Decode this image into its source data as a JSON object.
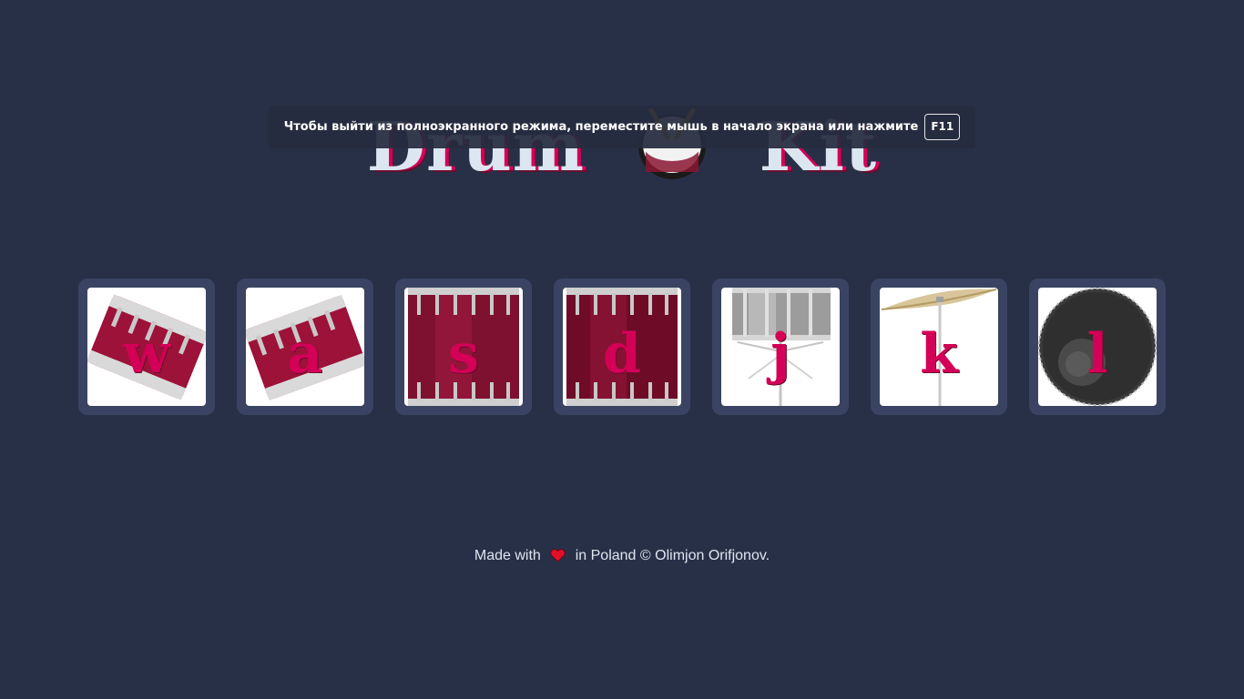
{
  "header": {
    "title_left": "Drum",
    "title_right": "Kit"
  },
  "fullscreen_notice": {
    "message": "Чтобы выйти из полноэкранного режима, переместите мышь в начало экрана или нажмите",
    "key": "F11"
  },
  "drums": [
    {
      "key": "w",
      "icon": "tom-drum-icon"
    },
    {
      "key": "a",
      "icon": "tom-drum-icon"
    },
    {
      "key": "s",
      "icon": "floor-tom-icon"
    },
    {
      "key": "d",
      "icon": "floor-tom-icon"
    },
    {
      "key": "j",
      "icon": "snare-drum-icon"
    },
    {
      "key": "k",
      "icon": "cymbal-icon"
    },
    {
      "key": "l",
      "icon": "bass-drum-icon"
    }
  ],
  "footer": {
    "prefix": "Made with",
    "suffix": "in Poland © Olimjon Orifjonov."
  },
  "colors": {
    "background": "#283048",
    "accent": "#d40057",
    "tile_frame": "#3a4462",
    "title_text": "#dbe6f0"
  }
}
